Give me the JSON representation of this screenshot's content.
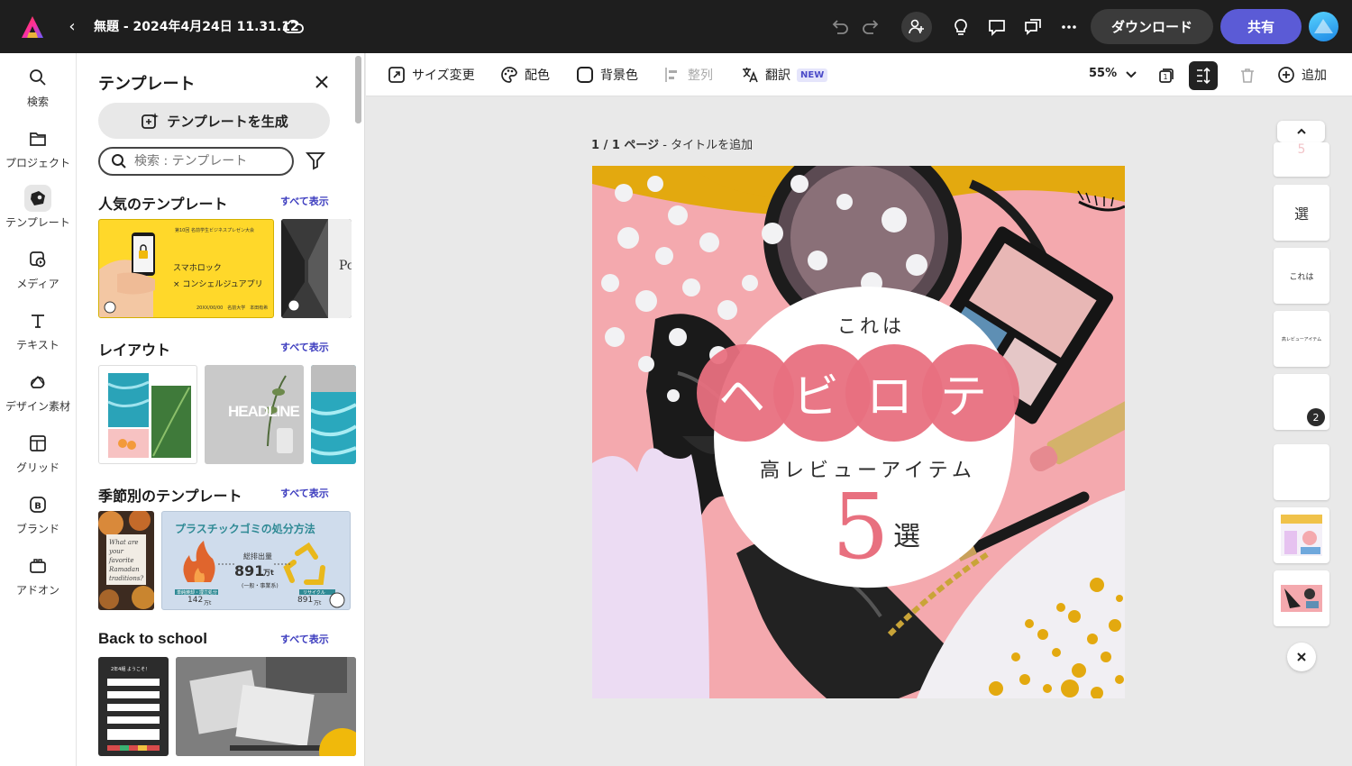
{
  "topbar": {
    "doc_title": "無題 - 2024年4月24日 11.31.12",
    "download_label": "ダウンロード",
    "share_label": "共有"
  },
  "rail": {
    "items": [
      {
        "label": "検索",
        "icon": "search-icon"
      },
      {
        "label": "プロジェクト",
        "icon": "folder-icon"
      },
      {
        "label": "テンプレート",
        "icon": "template-icon"
      },
      {
        "label": "メディア",
        "icon": "media-icon"
      },
      {
        "label": "テキスト",
        "icon": "text-icon"
      },
      {
        "label": "デザイン素材",
        "icon": "shapes-icon"
      },
      {
        "label": "グリッド",
        "icon": "grid-icon"
      },
      {
        "label": "ブランド",
        "icon": "brand-icon"
      },
      {
        "label": "アドオン",
        "icon": "addons-icon"
      }
    ],
    "active_index": 2
  },
  "panel": {
    "title": "テンプレート",
    "generate_label": "テンプレートを生成",
    "search_placeholder": "検索 : テンプレート",
    "see_all": "すべて表示",
    "sections": {
      "popular": "人気のテンプレート",
      "layout": "レイアウト",
      "seasonal": "季節別のテンプレート",
      "school": "Back to school"
    },
    "popular_thumb": {
      "header": "第10回 名前学生ビジネスプレゼン大会",
      "line1": "スマホロック",
      "line2": "× コンシェルジュアプリ",
      "footer": "20XX/00/00　名前大学　本田有希",
      "second_text": "Po"
    },
    "layout_thumb": {
      "headline": "HEADLINE"
    },
    "seasonal_thumb": {
      "card_text": "What are your favorite Ramadan traditions?",
      "title": "プラスチックゴミの処分方法",
      "total_label": "総排出量",
      "total_value": "891",
      "total_unit": "万t",
      "total_sub": "(一般・事業系)",
      "left_label": "単純焼却・埋立処分",
      "left_value": "142",
      "left_unit": "万t",
      "right_label": "リサイクル",
      "right_value": "891",
      "right_unit": "万t"
    },
    "school_thumb": {
      "header": "2年4組 ようこそ！"
    }
  },
  "toolbar": {
    "resize": "サイズ変更",
    "color": "配色",
    "background": "背景色",
    "align": "整列",
    "translate": "翻訳",
    "new_badge": "NEW",
    "zoom": "55%",
    "add": "追加"
  },
  "canvas": {
    "page_label_bold": "1 / 1 ページ",
    "page_label_rest": " - タイトルを追加",
    "small_heading": "これは",
    "big_text": "ヘビロテ",
    "subtitle": "高レビューアイテム",
    "number": "5",
    "suffix": "選"
  },
  "pages": {
    "items": [
      "5",
      "選",
      "これは",
      "高レビューアイテム",
      "",
      "",
      "",
      ""
    ],
    "count_badge": "2"
  },
  "colors": {
    "accent": "#5b5bd6",
    "pink": "#e8707f",
    "yellow": "#e3a90f",
    "lavender": "#ecdcf3"
  }
}
